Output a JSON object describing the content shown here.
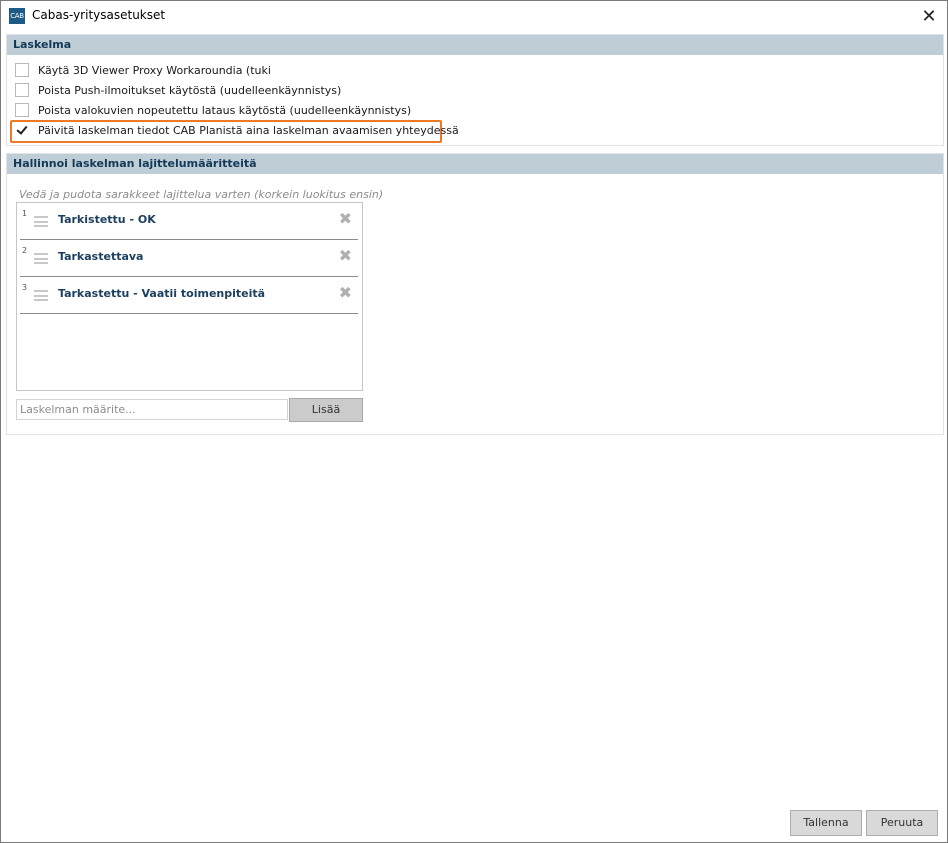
{
  "window": {
    "icon_text": "CAB",
    "title": "Cabas-yritysasetukset",
    "close_symbol": "✕"
  },
  "laskelma": {
    "header": "Laskelma",
    "options": [
      {
        "label": "Käytä 3D Viewer Proxy Workaroundia (tuki",
        "checked": false
      },
      {
        "label": "Poista Push-ilmoitukset käytöstä (uudelleenkäynnistys)",
        "checked": false
      },
      {
        "label": "Poista valokuvien nopeutettu lataus käytöstä (uudelleenkäynnistys)",
        "checked": false
      },
      {
        "label": "Päivitä laskelman tiedot CAB Planistä aina laskelman avaamisen yhteydessä",
        "checked": true
      }
    ]
  },
  "sorting": {
    "header": "Hallinnoi laskelman lajittelumääritteitä",
    "hint": "Vedä ja pudota sarakkeet lajittelua varten (korkein luokitus ensin)",
    "items": [
      {
        "rank": "1",
        "label": "Tarkistettu - OK"
      },
      {
        "rank": "2",
        "label": "Tarkastettava"
      },
      {
        "rank": "3",
        "label": "Tarkastettu - Vaatii toimenpiteitä"
      }
    ],
    "remove_symbol": "✖",
    "input_placeholder": "Laskelman määrite...",
    "input_value": "",
    "add_label": "Lisää"
  },
  "footer": {
    "save_label": "Tallenna",
    "cancel_label": "Peruuta"
  },
  "colors": {
    "section_header_bg": "#bfcdd6",
    "section_header_text": "#123a57",
    "highlight_border": "#ec7a26",
    "item_label": "#1b3f5e"
  }
}
